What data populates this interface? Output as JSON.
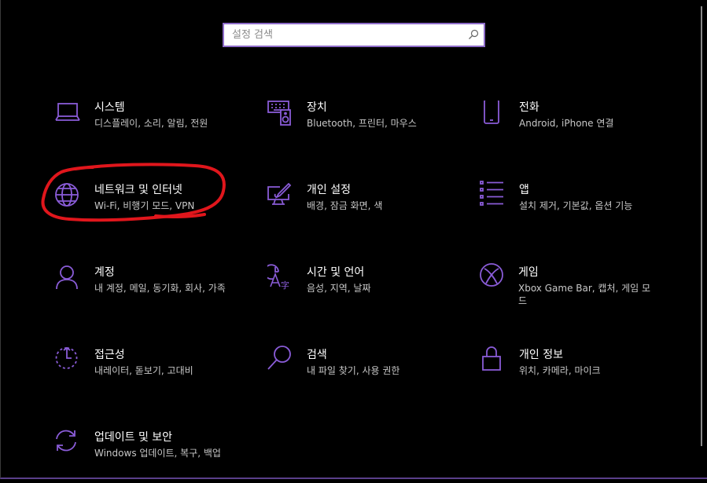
{
  "search": {
    "placeholder": "설정 검색",
    "icon": "search-icon"
  },
  "colors": {
    "accent": "#8a5cd8",
    "background": "#000000",
    "annotation": "#e0161c"
  },
  "tiles": [
    {
      "title": "시스템",
      "desc": "디스플레이, 소리, 알림, 전원",
      "icon": "laptop-icon"
    },
    {
      "title": "장치",
      "desc": "Bluetooth, 프린터, 마우스",
      "icon": "keyboard-speaker-icon"
    },
    {
      "title": "전화",
      "desc": "Android, iPhone 연결",
      "icon": "phone-icon"
    },
    {
      "title": "네트워크 및 인터넷",
      "desc": "Wi-Fi, 비행기 모드, VPN",
      "icon": "globe-icon"
    },
    {
      "title": "개인 설정",
      "desc": "배경, 잠금 화면, 색",
      "icon": "paint-display-icon"
    },
    {
      "title": "앱",
      "desc": "설치 제거, 기본값, 옵션 기능",
      "icon": "app-list-icon"
    },
    {
      "title": "계정",
      "desc": "내 계정, 메일, 동기화, 회사, 가족",
      "icon": "person-icon"
    },
    {
      "title": "시간 및 언어",
      "desc": "음성, 지역, 날짜",
      "icon": "clock-language-icon"
    },
    {
      "title": "게임",
      "desc": "Xbox Game Bar, 캡처, 게임 모드",
      "icon": "xbox-icon"
    },
    {
      "title": "접근성",
      "desc": "내레이터, 돋보기, 고대비",
      "icon": "ease-of-access-icon"
    },
    {
      "title": "검색",
      "desc": "내 파일 찾기, 사용 권한",
      "icon": "search-icon"
    },
    {
      "title": "개인 정보",
      "desc": "위치, 카메라, 마이크",
      "icon": "lock-icon"
    },
    {
      "title": "업데이트 및 보안",
      "desc": "Windows 업데이트, 복구, 백업",
      "icon": "sync-icon"
    }
  ]
}
